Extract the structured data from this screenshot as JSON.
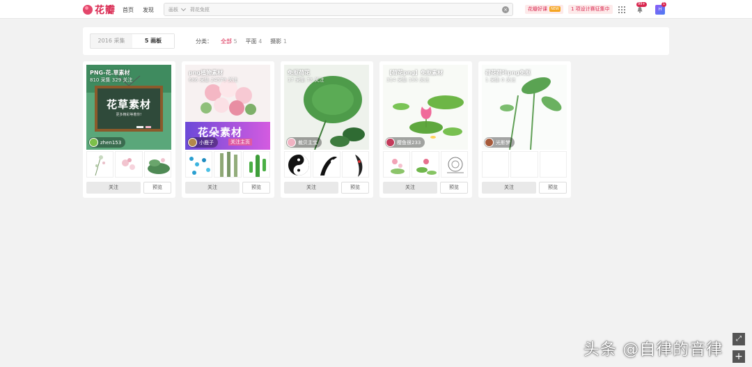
{
  "header": {
    "logo": "花瓣",
    "nav": [
      "首页",
      "发现"
    ],
    "search_scope": "画板",
    "search_value": "荷花免抠",
    "promo": "花瓣好课",
    "promo_badge": "NEW",
    "contest": "1 项设计赛征集中",
    "notify_count": "99+",
    "avatar_count": "1",
    "avatar_text": "H"
  },
  "filter": {
    "tabs": [
      {
        "label": "2016 采集"
      },
      {
        "label": "5 画板"
      }
    ],
    "label": "分类：",
    "items": [
      {
        "name": "全部",
        "count": "5"
      },
      {
        "name": "平面",
        "count": "4"
      },
      {
        "name": "摄影",
        "count": "1"
      }
    ]
  },
  "boards": [
    {
      "title": "PNG-花.草素材",
      "stats": "810 采集  329 关注",
      "owner": "zhen153",
      "cover_text": "花草素材",
      "cover_sub": "更多精彩等着你!",
      "follow": "关注",
      "preview": "预览"
    },
    {
      "title": "png植物素材",
      "stats": "686 采集  24579 关注",
      "owner": "小鹿子",
      "cover_text": "花朵素材",
      "cover_sub": "关注主页",
      "follow": "关注",
      "preview": "预览"
    },
    {
      "title": "免抠荷花",
      "stats": "17 采集  73 关注",
      "owner": "裁贝主宝",
      "follow": "关注",
      "preview": "预览"
    },
    {
      "title": "【荷花png】免抠素材",
      "stats": "314 采集  193 关注",
      "owner": "樱鱼很233",
      "follow": "关注",
      "preview": "预览"
    },
    {
      "title": "荷花荷叶png免抠",
      "stats": "1 采集  0 关注",
      "owner": "光影梦",
      "follow": "关注",
      "preview": "预览"
    }
  ],
  "watermark": "头条 @自律的音律",
  "colors": {
    "brand": "#d9254e",
    "chalkboard": "#2f5a3c",
    "leaf": "#4e9b4a"
  }
}
